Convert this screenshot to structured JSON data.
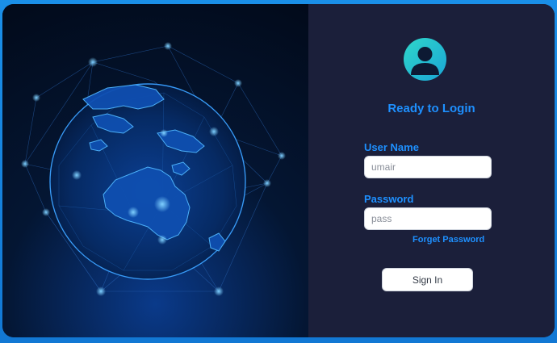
{
  "login": {
    "title": "Ready to Login",
    "username_label": "User Name",
    "username_value": "umair",
    "password_label": "Password",
    "password_value": "pass",
    "forget_password": "Forget Password",
    "signin_label": "Sign In"
  },
  "icons": {
    "avatar": "user-avatar-icon",
    "globe": "globe-network-illustration"
  },
  "colors": {
    "accent": "#1e90ff",
    "panel_background": "#1b1f3a",
    "avatar_gradient_start": "#2fd6c9",
    "avatar_gradient_end": "#1aa6d6",
    "page_border": "#1a8fe8"
  }
}
